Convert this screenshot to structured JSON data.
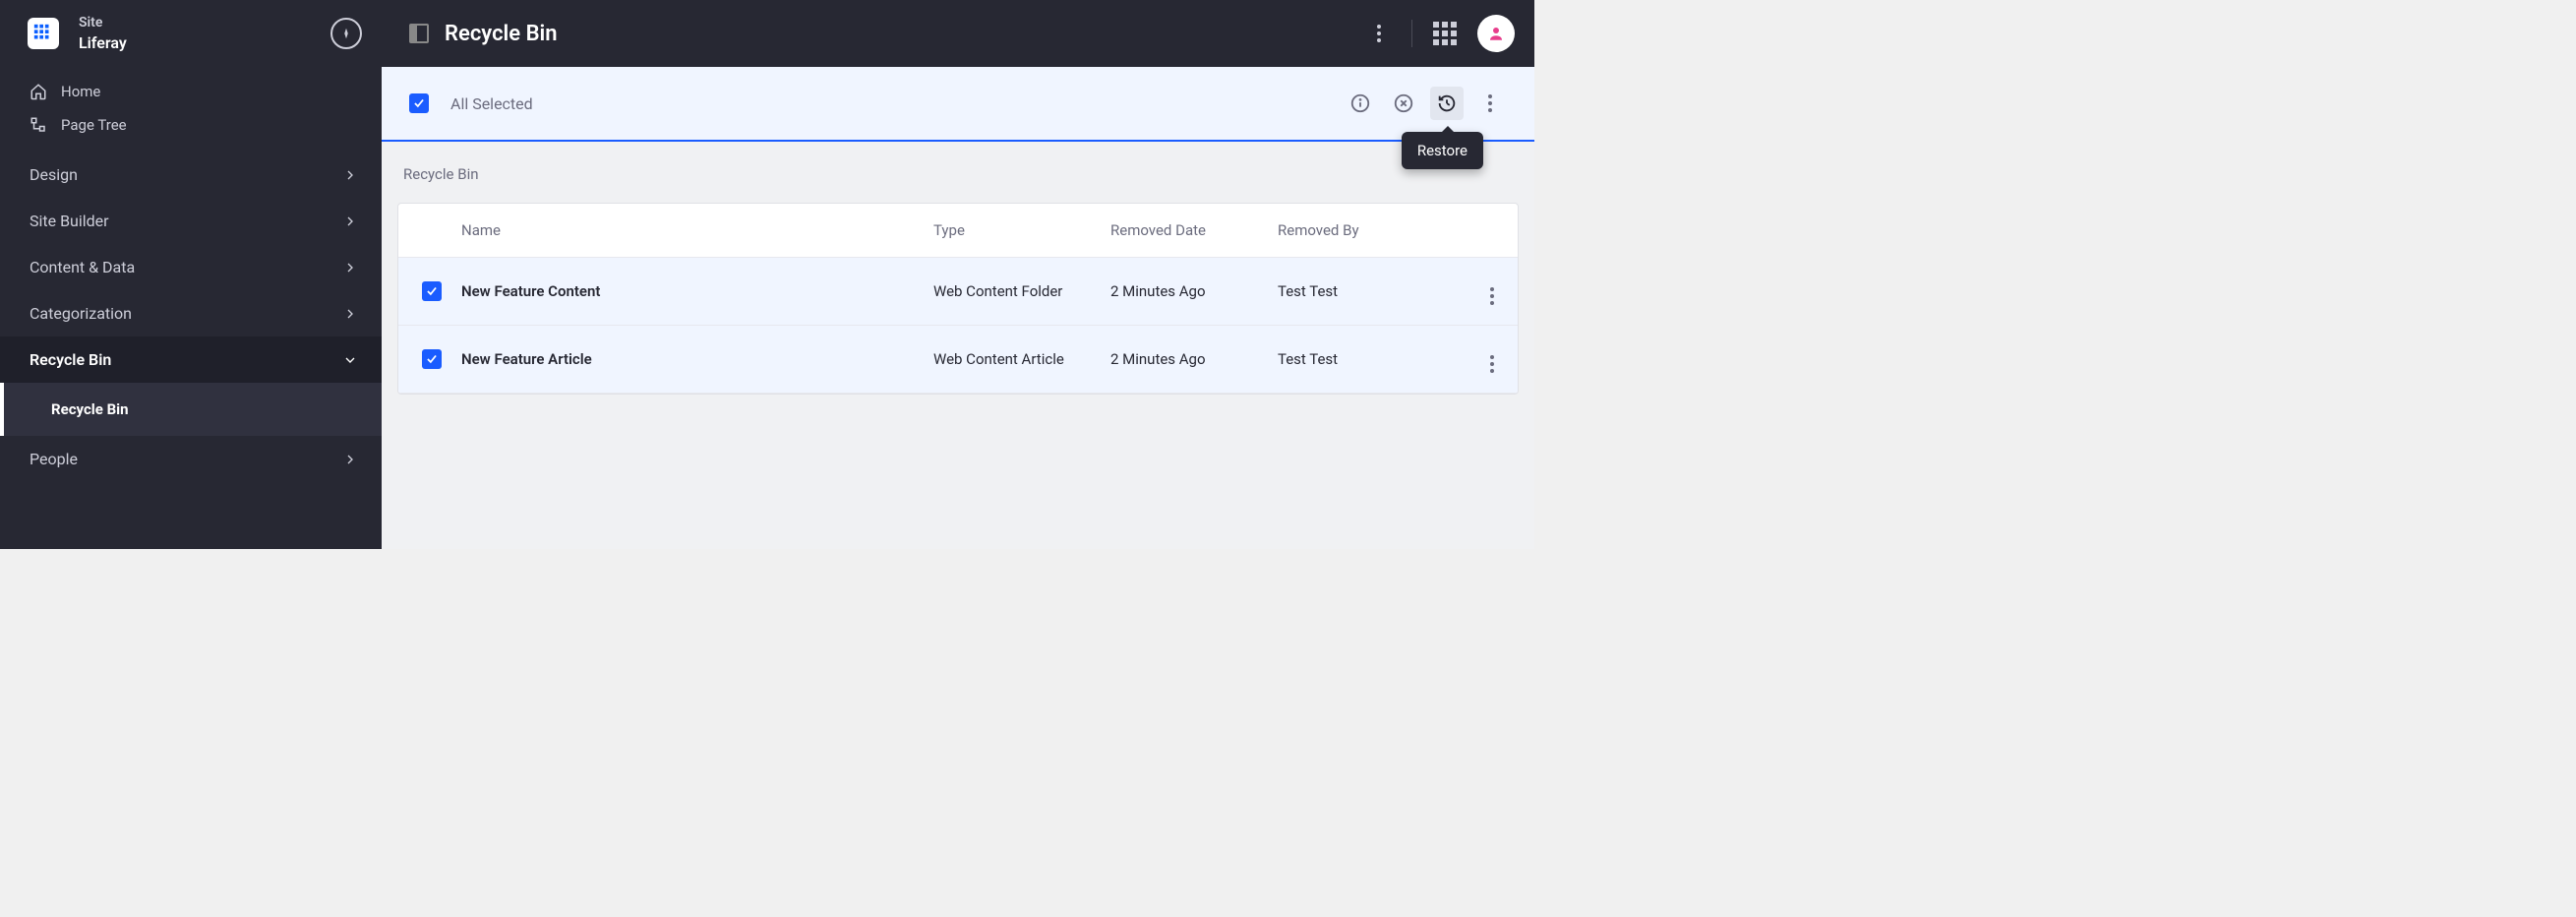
{
  "site": {
    "label": "Site",
    "name": "Liferay"
  },
  "nav_quick": [
    {
      "label": "Home"
    },
    {
      "label": "Page Tree"
    }
  ],
  "nav_main": [
    {
      "label": "Design",
      "expanded": false
    },
    {
      "label": "Site Builder",
      "expanded": false
    },
    {
      "label": "Content & Data",
      "expanded": false
    },
    {
      "label": "Categorization",
      "expanded": false
    },
    {
      "label": "Recycle Bin",
      "expanded": true,
      "children": [
        {
          "label": "Recycle Bin"
        }
      ]
    },
    {
      "label": "People",
      "expanded": false
    }
  ],
  "header": {
    "title": "Recycle Bin"
  },
  "selection": {
    "label": "All Selected",
    "tooltip": "Restore"
  },
  "breadcrumb": "Recycle Bin",
  "table": {
    "columns": {
      "name": "Name",
      "type": "Type",
      "removed_date": "Removed Date",
      "removed_by": "Removed By"
    },
    "rows": [
      {
        "name": "New Feature Content",
        "type": "Web Content Folder",
        "removed_date": "2 Minutes Ago",
        "removed_by": "Test Test"
      },
      {
        "name": "New Feature Article",
        "type": "Web Content Article",
        "removed_date": "2 Minutes Ago",
        "removed_by": "Test Test"
      }
    ]
  }
}
